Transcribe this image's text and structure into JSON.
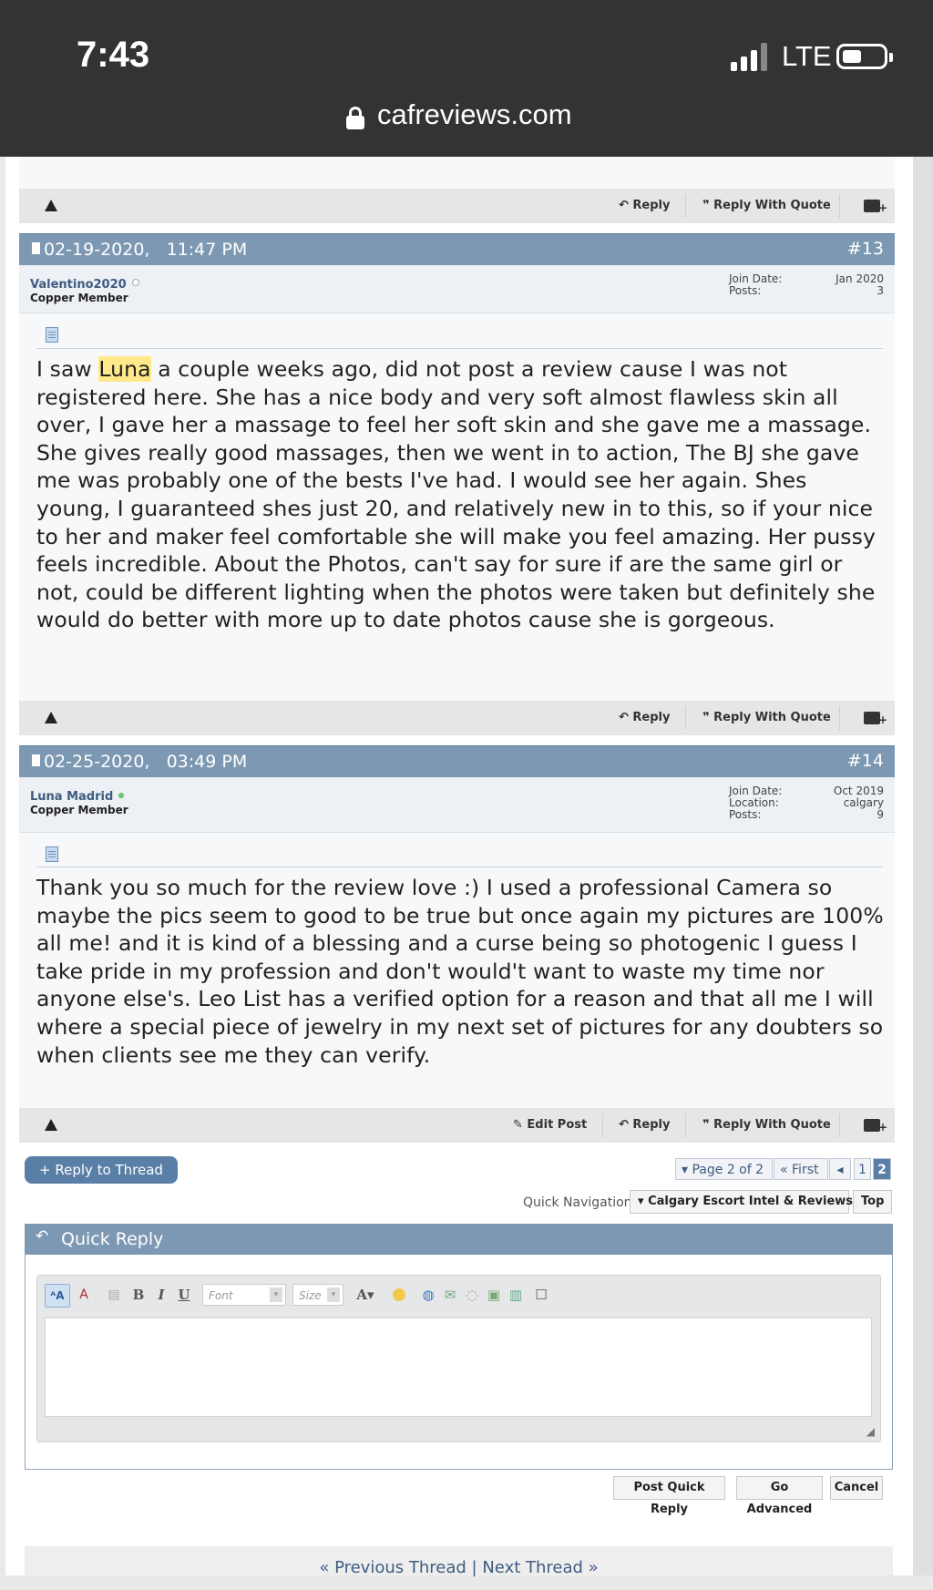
{
  "status": {
    "time": "7:43",
    "network": "LTE",
    "url": "cafreviews.com"
  },
  "toolbar": {
    "reply": "Reply",
    "reply_with_quote": "Reply With Quote",
    "edit_post": "Edit Post"
  },
  "posts": [
    {
      "date": "02-19-2020,",
      "time": "11:47 PM",
      "number": "#13",
      "username": "Valentino2020",
      "rank": "Copper Member",
      "online": false,
      "info_labels": "Join Date:\nPosts:",
      "info_values": "Jan 2020\n3",
      "text_before": "I saw ",
      "highlight": "Luna",
      "text_after": " a couple weeks ago, did not post a review cause I was not registered here. She has a nice body and very soft almost flawless skin all over, I gave her a massage to feel her soft skin and she gave me a massage. She gives really good massages, then we went in to action, The BJ she gave me was probably one of the bests I've had. I would see her again. Shes young, I guaranteed shes just 20, and relatively new in to this, so if your nice to her and maker feel comfortable she will make you feel amazing. Her pussy feels incredible. About the Photos, can't say for sure if are the same girl or not, could be different lighting when the photos were taken but definitely she would do better with more up to date photos cause she is gorgeous."
    },
    {
      "date": "02-25-2020,",
      "time": "03:49 PM",
      "number": "#14",
      "username": "Luna Madrid",
      "rank": "Copper Member",
      "online": true,
      "info_labels": "Join Date:\nLocation:\nPosts:",
      "info_values": "Oct 2019\ncalgary\n9",
      "text": "Thank you so much for the review love :) I used a professional Camera so maybe the pics seem to good to be true but once again my pictures are 100% all me! and it is kind of a blessing and a curse being so photogenic I guess I take pride in my profession and don't would't want to waste my time nor anyone else's. Leo List has a verified option for a reason and that all me I will where a special piece of jewelry in my next set of pictures for any doubters so when clients see me they can verify."
    }
  ],
  "thread": {
    "reply_to_thread": "+ Reply to Thread",
    "page_label": "Page 2 of 2",
    "first": "First",
    "pages": [
      "1",
      "2"
    ],
    "current_page": "2",
    "quick_nav_label": "Quick Navigation",
    "quick_nav_forum": "Calgary Escort Intel & Reviews",
    "top": "Top"
  },
  "quick_reply": {
    "title": "Quick Reply",
    "font_placeholder": "Font",
    "size_placeholder": "Size",
    "post_button": "Post Quick Reply",
    "advanced_button": "Go Advanced",
    "cancel_button": "Cancel"
  },
  "nav": {
    "previous": "« Previous Thread",
    "separator": "|",
    "next": "Next Thread »"
  }
}
